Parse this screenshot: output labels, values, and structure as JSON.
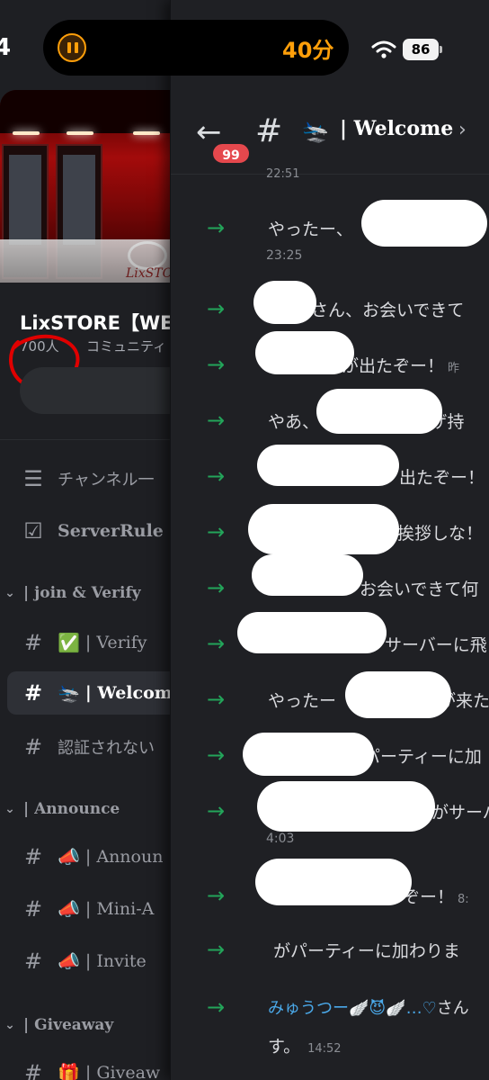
{
  "status_bar": {
    "time_fragment": "4",
    "timer": "40分",
    "battery": "86",
    "wifi_icon": "wifi-icon",
    "pause_icon": "pause-icon"
  },
  "server": {
    "banner_watermark": "LixSTORE",
    "name": "LixSTORE【WE",
    "member_count": "700人",
    "type": "コミュニティ"
  },
  "channels": [
    {
      "icon": "list-search-icon",
      "glyph": "☰",
      "label": "チャンネル一",
      "emoji": ""
    },
    {
      "icon": "rules-icon",
      "glyph": "☑",
      "label": "ServerRule",
      "emoji": ""
    },
    {
      "icon": "hash-icon",
      "glyph": "#",
      "label": "| Verify",
      "emoji": "✅"
    },
    {
      "icon": "hash-icon",
      "glyph": "#",
      "label": "| Welcom",
      "emoji": "🛬"
    },
    {
      "icon": "hash-icon",
      "glyph": "#",
      "label": "認証されない",
      "emoji": ""
    },
    {
      "icon": "hash-lock-icon",
      "glyph": "#",
      "label": "| Announ",
      "emoji": "📣"
    },
    {
      "icon": "hash-lock-icon",
      "glyph": "#",
      "label": "| Mini-A",
      "emoji": "📣"
    },
    {
      "icon": "hash-lock-icon",
      "glyph": "#",
      "label": "| Invite",
      "emoji": "📣"
    },
    {
      "icon": "hash-lock-icon",
      "glyph": "#",
      "label": "| Giveaw",
      "emoji": "🎁"
    }
  ],
  "categories": [
    {
      "label": "| join & Verify"
    },
    {
      "label": "| Announce"
    },
    {
      "label": "| Giveaway"
    }
  ],
  "chat": {
    "back_icon": "arrow-left-icon",
    "unread_badge": "99",
    "channel_emoji": "🛬",
    "channel_title": "| Welcome",
    "cut_timestamp": "22:51",
    "messages": [
      {
        "text": "やったー、",
        "timestamp": "23:25",
        "inline_timestamp": ""
      },
      {
        "text": "さん、お会いできて",
        "timestamp": "",
        "inline_timestamp": ""
      },
      {
        "text": "が出たぞー！",
        "timestamp": "",
        "inline_timestamp": "昨"
      },
      {
        "text": "やあ、　　　　　　ピザ持",
        "timestamp": "",
        "inline_timestamp": ""
      },
      {
        "text": "出たぞー！",
        "timestamp": "",
        "inline_timestamp": ""
      },
      {
        "text": "挨拶しな！",
        "timestamp": "",
        "inline_timestamp": ""
      },
      {
        "text": "お会いできて何",
        "timestamp": "",
        "inline_timestamp": ""
      },
      {
        "text": "サーバーに飛",
        "timestamp": "",
        "inline_timestamp": ""
      },
      {
        "text": "やったー　　　　　　が来た",
        "timestamp": "",
        "inline_timestamp": ""
      },
      {
        "text": "パーティーに加",
        "timestamp": "",
        "inline_timestamp": ""
      },
      {
        "text": "がサーバ",
        "timestamp": "4:03",
        "inline_timestamp": ""
      },
      {
        "text": "ぞー！",
        "timestamp": "",
        "inline_timestamp": "8:"
      },
      {
        "text": "がパーティーに加わりま",
        "timestamp": "",
        "inline_timestamp": ""
      },
      {
        "name": "みゅうつー🪽😈🪽…♡",
        "text": "さん",
        "continuation": "す。",
        "timestamp": "14:52"
      }
    ]
  }
}
